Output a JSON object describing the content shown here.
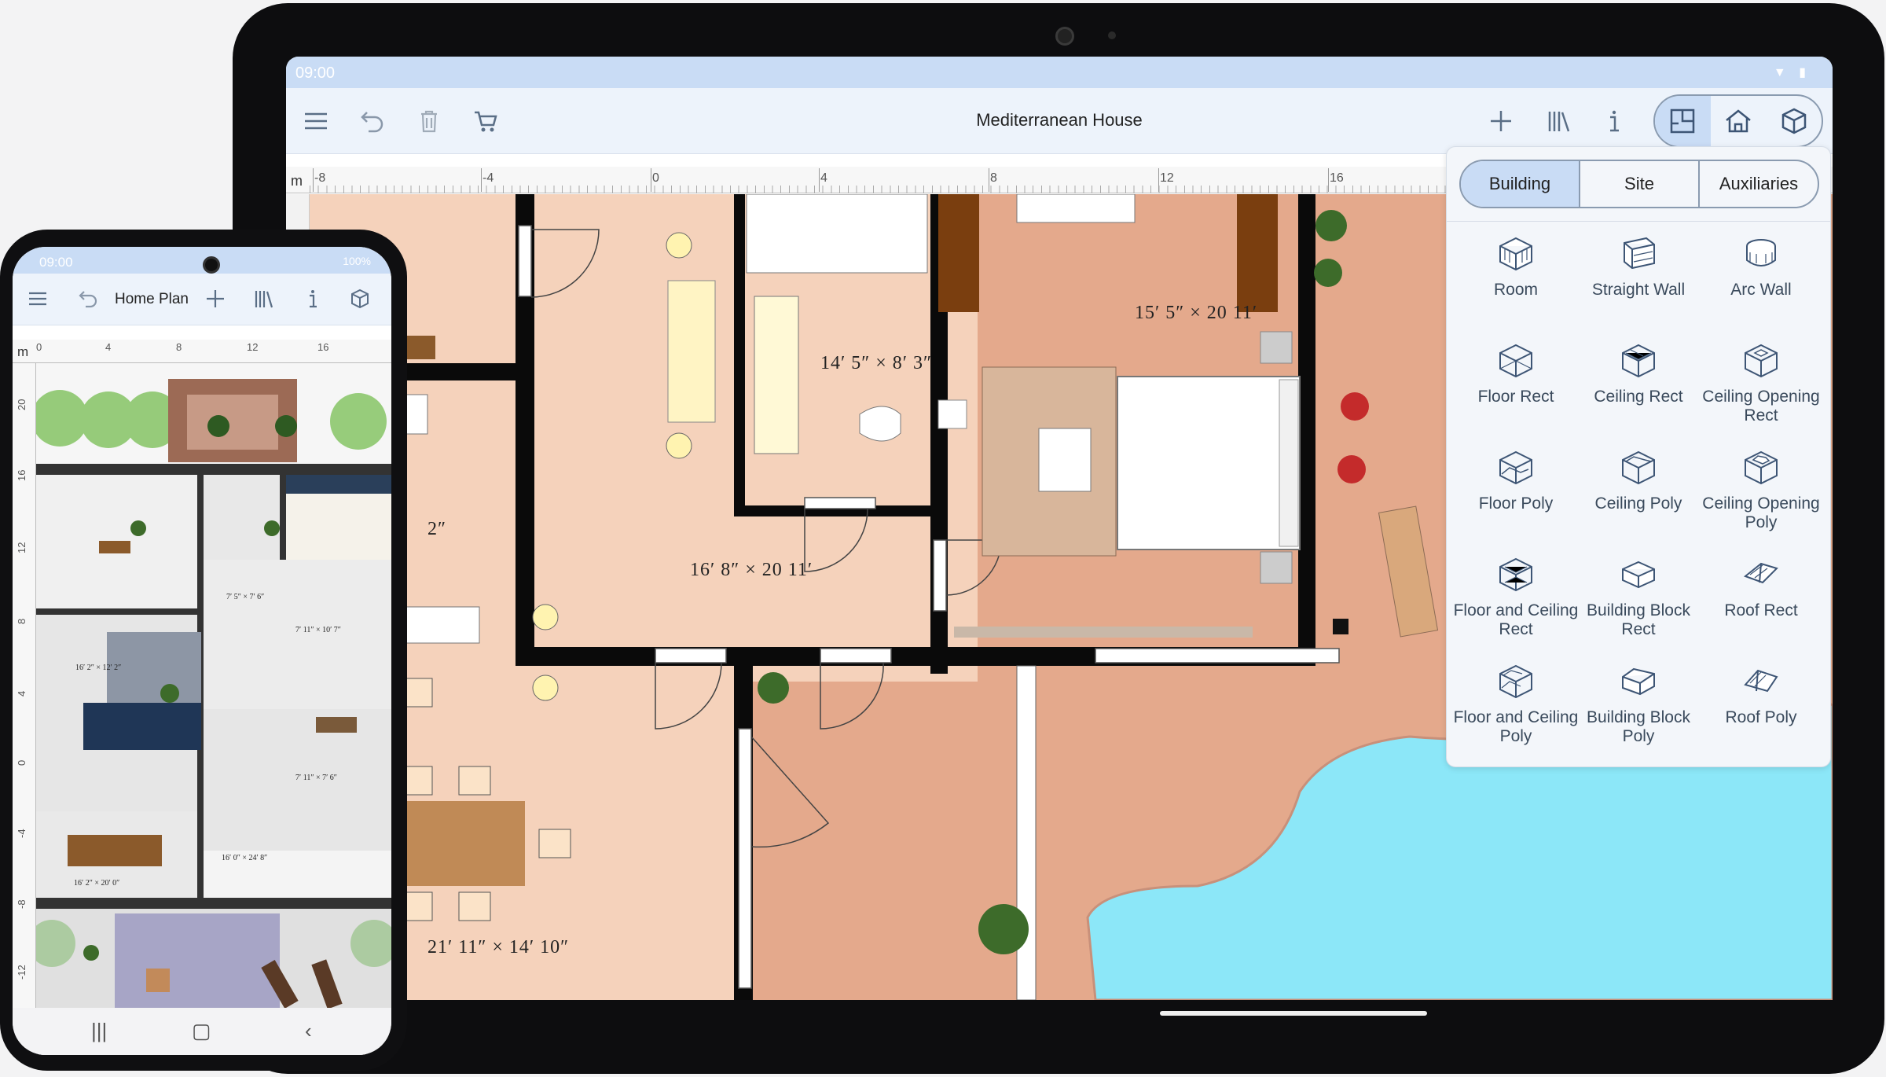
{
  "tablet": {
    "status": {
      "time": "09:00"
    },
    "toolbar": {
      "title": "Mediterranean House",
      "menu_icon": "menu-icon",
      "undo_icon": "undo-icon",
      "delete_icon": "trash-icon",
      "cart_icon": "cart-icon",
      "add_icon": "plus-icon",
      "library_icon": "library-icon",
      "info_icon": "info-icon",
      "views": [
        "plan-view-icon",
        "3d-house-icon",
        "3d-box-icon"
      ]
    },
    "ruler": {
      "unit": "m",
      "ticks": [
        "-8",
        "-4",
        "0",
        "4",
        "8",
        "12",
        "16"
      ]
    },
    "rooms": [
      {
        "label": "15′ 5″ × 20 11′"
      },
      {
        "label": "14′ 5″ × 8′ 3″"
      },
      {
        "label": "16′ 8″ × 20 11′"
      },
      {
        "label": "2″"
      },
      {
        "label": "21′ 11″ × 14′ 10″"
      }
    ],
    "panel": {
      "tabs": [
        "Building",
        "Site",
        "Auxiliaries"
      ],
      "active_tab": "Building",
      "tools": [
        {
          "label": "Room"
        },
        {
          "label": "Straight Wall"
        },
        {
          "label": "Arc Wall"
        },
        {
          "label": "Floor Rect"
        },
        {
          "label": "Ceiling Rect"
        },
        {
          "label": "Ceiling Opening Rect"
        },
        {
          "label": "Floor Poly"
        },
        {
          "label": "Ceiling Poly"
        },
        {
          "label": "Ceiling Opening Poly"
        },
        {
          "label": "Floor and Ceiling Rect"
        },
        {
          "label": "Building Block Rect"
        },
        {
          "label": "Roof Rect"
        },
        {
          "label": "Floor and Ceiling Poly"
        },
        {
          "label": "Building Block Poly"
        },
        {
          "label": "Roof Poly"
        }
      ]
    }
  },
  "phone": {
    "status": {
      "time": "09:00",
      "battery": "100%"
    },
    "toolbar": {
      "title": "Home Plan"
    },
    "ruler": {
      "unit": "m",
      "ticks": [
        "0",
        "4",
        "8",
        "12",
        "16"
      ]
    },
    "vruler": [
      "20",
      "16",
      "12",
      "8",
      "4",
      "0",
      "-4",
      "-8",
      "-12"
    ],
    "rooms": [
      {
        "label": "7′ 5″ × 7′ 6″"
      },
      {
        "label": "16′ 2″ × 12′ 2″"
      },
      {
        "label": "7′ 11″ × 10′ 7″"
      },
      {
        "label": "7′ 11″ × 7′ 6″"
      },
      {
        "label": "16′ 0″ × 24′ 8″"
      },
      {
        "label": "16′ 2″ × 20′ 0″"
      }
    ],
    "nav": [
      "recent-apps-icon",
      "home-icon",
      "back-icon"
    ]
  }
}
